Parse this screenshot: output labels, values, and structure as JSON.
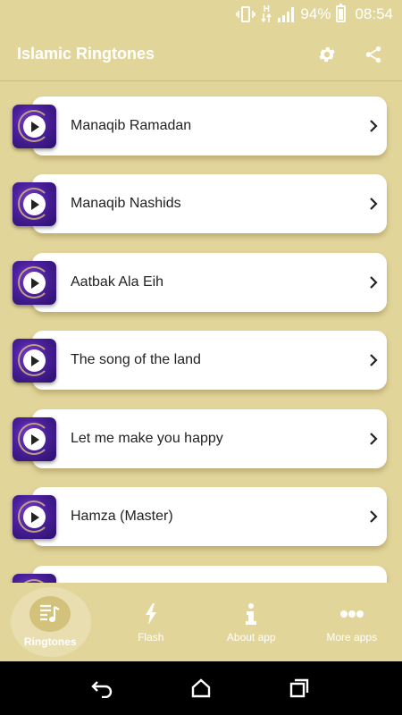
{
  "status_bar": {
    "battery": "94%",
    "time": "08:54",
    "network": "H"
  },
  "app_bar": {
    "title": "Islamic Ringtones",
    "settings_icon": "gear-icon",
    "share_icon": "share-icon"
  },
  "ringtones": [
    {
      "title": "Manaqib Ramadan"
    },
    {
      "title": "Manaqib Nashids"
    },
    {
      "title": "Aatbak Ala Eih"
    },
    {
      "title": "The song of the land"
    },
    {
      "title": "Let me make you happy"
    },
    {
      "title": "Hamza (Master)"
    },
    {
      "title": ""
    }
  ],
  "bottom_nav": {
    "items": [
      {
        "label": "Ringtones",
        "icon": "music-list-icon"
      },
      {
        "label": "Flash",
        "icon": "flash-icon"
      },
      {
        "label": "About app",
        "icon": "info-icon"
      },
      {
        "label": "More apps",
        "icon": "more-icon"
      }
    ],
    "active": "Ringtones"
  },
  "colors": {
    "background": "#e2d59a",
    "card": "#ffffff",
    "thumb": "#4a1f9a"
  }
}
